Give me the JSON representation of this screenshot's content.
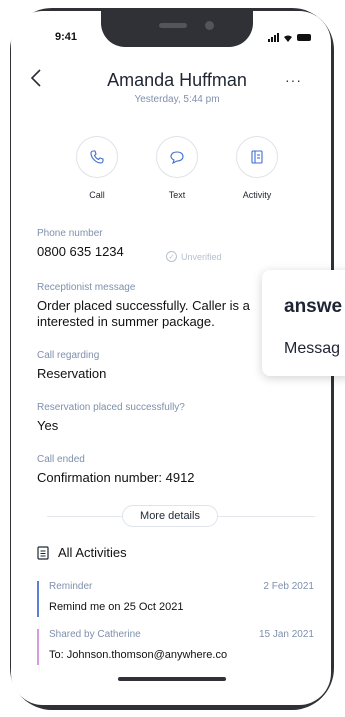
{
  "status": {
    "time": "9:41"
  },
  "contact": {
    "name": "Amanda Huffman",
    "timestamp": "Yesterday, 5:44 pm"
  },
  "header": {
    "back_icon": "chevron-left-icon",
    "more_label": "···"
  },
  "actions": [
    {
      "label": "Call",
      "icon": "phone-icon"
    },
    {
      "label": "Text",
      "icon": "chat-bubble-icon"
    },
    {
      "label": "Activity",
      "icon": "notebook-icon"
    }
  ],
  "fields": {
    "phone_label": "Phone number",
    "phone_value": "0800 635 1234",
    "unverified": "Unverified",
    "receptionist_label": "Receptionist message",
    "receptionist_value": "Order placed successfully. Caller is a interested in summer package.",
    "call_regarding_label": "Call regarding",
    "call_regarding_value": "Reservation",
    "reservation_label": "Reservation placed successfully?",
    "reservation_value": "Yes",
    "call_ended_label": "Call ended",
    "call_ended_value": "Confirmation number: 4912"
  },
  "more_details": "More details",
  "activities": {
    "title": "All Activities",
    "items": [
      {
        "type": "Reminder",
        "date": "2 Feb 2021",
        "text": "Remind me on 25 Oct 2021",
        "color": "#5b7fd6"
      },
      {
        "type": "Shared by Catherine",
        "date": "15 Jan 2021",
        "text": "To: Johnson.thomson@anywhere.co",
        "color": "#d69ae0"
      }
    ]
  },
  "overlay": {
    "brand": "answe",
    "message": "Messag"
  }
}
